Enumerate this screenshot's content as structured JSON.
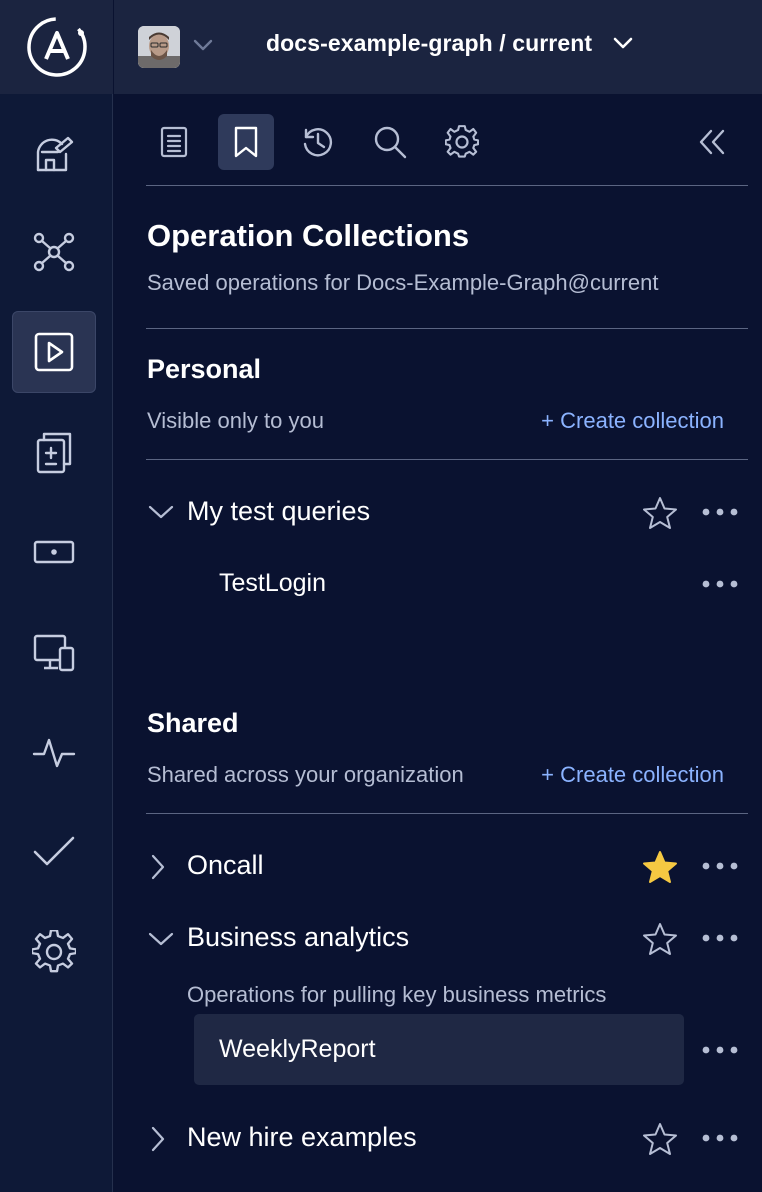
{
  "colors": {
    "background": "#0a1230",
    "rail": "#0e1937",
    "topbar": "#1b2440",
    "accent_link": "#8bb3ff",
    "star_filled": "#f5c842",
    "muted_text": "#b5bdd3"
  },
  "topbar": {
    "graph_title": "docs-example-graph / current"
  },
  "rail": {
    "logo": "apollo-logo",
    "items": [
      {
        "icon": "observatory-icon",
        "active": false
      },
      {
        "icon": "schema-graph-icon",
        "active": false
      },
      {
        "icon": "explorer-play-icon",
        "active": true
      },
      {
        "icon": "changelog-icon",
        "active": false
      },
      {
        "icon": "operations-icon",
        "active": false
      },
      {
        "icon": "clients-icon",
        "active": false
      },
      {
        "icon": "insights-pulse-icon",
        "active": false
      },
      {
        "icon": "checks-icon",
        "active": false
      },
      {
        "icon": "settings-icon",
        "active": false
      }
    ]
  },
  "toolbar": {
    "tools": [
      {
        "icon": "documentation-icon",
        "active": false
      },
      {
        "icon": "bookmark-icon",
        "active": true
      },
      {
        "icon": "history-icon",
        "active": false
      },
      {
        "icon": "search-icon",
        "active": false
      },
      {
        "icon": "gear-icon",
        "active": false
      }
    ],
    "collapse_icon": "collapse-double-chevron-icon"
  },
  "header": {
    "title": "Operation Collections",
    "subtitle": "Saved operations for Docs-Example-Graph@current"
  },
  "personal": {
    "title": "Personal",
    "subtitle": "Visible only to you",
    "create_label": "+ Create collection",
    "collections": [
      {
        "name": "My test queries",
        "expanded": true,
        "starred": false,
        "operations": [
          {
            "name": "TestLogin"
          }
        ]
      }
    ]
  },
  "shared": {
    "title": "Shared",
    "subtitle": "Shared across your organization",
    "create_label": "+ Create collection",
    "collections": [
      {
        "name": "Oncall",
        "expanded": false,
        "starred": true
      },
      {
        "name": "Business analytics",
        "expanded": true,
        "starred": false,
        "description": "Operations for pulling key business metrics",
        "operations": [
          {
            "name": "WeeklyReport",
            "selected": true
          }
        ]
      },
      {
        "name": "New hire examples",
        "expanded": false,
        "starred": false
      }
    ]
  }
}
